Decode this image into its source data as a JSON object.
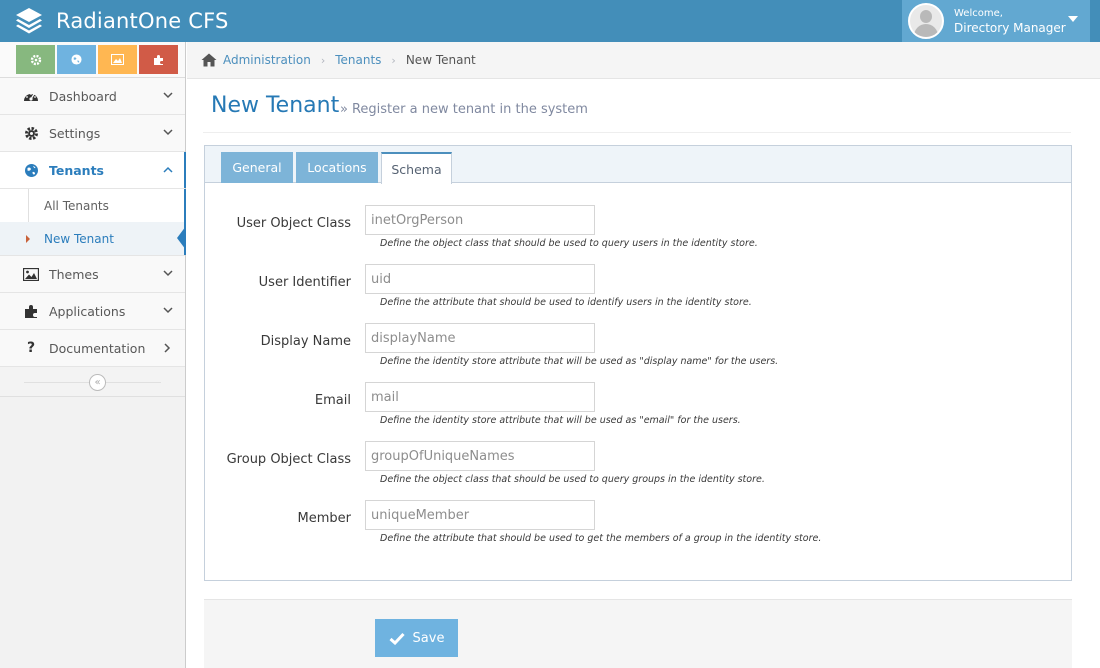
{
  "app": {
    "title": "RadiantOne CFS"
  },
  "user": {
    "welcome": "Welcome,",
    "name": "Directory Manager"
  },
  "colors": {
    "header": "#438eb9",
    "accent": "#2b7dbc",
    "tab": "#7db4d8",
    "save": "#6fb3e0"
  },
  "shortcuts": [
    {
      "icon": "gear-icon",
      "color": "#87b87f"
    },
    {
      "icon": "globe-icon",
      "color": "#6fb3e0"
    },
    {
      "icon": "picture-icon",
      "color": "#ffb752"
    },
    {
      "icon": "puzzle-icon",
      "color": "#d15b47"
    }
  ],
  "sidebar": {
    "items": [
      {
        "label": "Dashboard",
        "icon": "dashboard-icon"
      },
      {
        "label": "Settings",
        "icon": "gear-icon"
      },
      {
        "label": "Tenants",
        "icon": "globe-icon",
        "active": true
      },
      {
        "label": "Themes",
        "icon": "picture-icon"
      },
      {
        "label": "Applications",
        "icon": "puzzle-icon"
      },
      {
        "label": "Documentation",
        "icon": "question-icon"
      }
    ],
    "tenant_subitems": [
      {
        "label": "All Tenants"
      },
      {
        "label": "New Tenant",
        "current": true
      }
    ]
  },
  "breadcrumb": {
    "items": [
      "Administration",
      "Tenants"
    ],
    "current": "New Tenant"
  },
  "page": {
    "title": "New Tenant",
    "subtitle": "Register a new tenant in the system"
  },
  "tabs": [
    {
      "label": "General"
    },
    {
      "label": "Locations"
    },
    {
      "label": "Schema",
      "active": true
    }
  ],
  "fields": [
    {
      "label": "User Object Class",
      "value": "inetOrgPerson",
      "help": "Define the object class that should be used to query users in the identity store."
    },
    {
      "label": "User Identifier",
      "value": "uid",
      "help": "Define the attribute that should be used to identify users in the identity store."
    },
    {
      "label": "Display Name",
      "value": "displayName",
      "help": "Define the identity store attribute that will be used as \"display name\" for the users."
    },
    {
      "label": "Email",
      "value": "mail",
      "help": "Define the identity store attribute that will be used as \"email\" for the users."
    },
    {
      "label": "Group Object Class",
      "value": "groupOfUniqueNames",
      "help": "Define the object class that should be used to query groups in the identity store."
    },
    {
      "label": "Member",
      "value": "uniqueMember",
      "help": "Define the attribute that should be used to get the members of a group in the identity store."
    }
  ],
  "actions": {
    "save_label": "Save"
  }
}
